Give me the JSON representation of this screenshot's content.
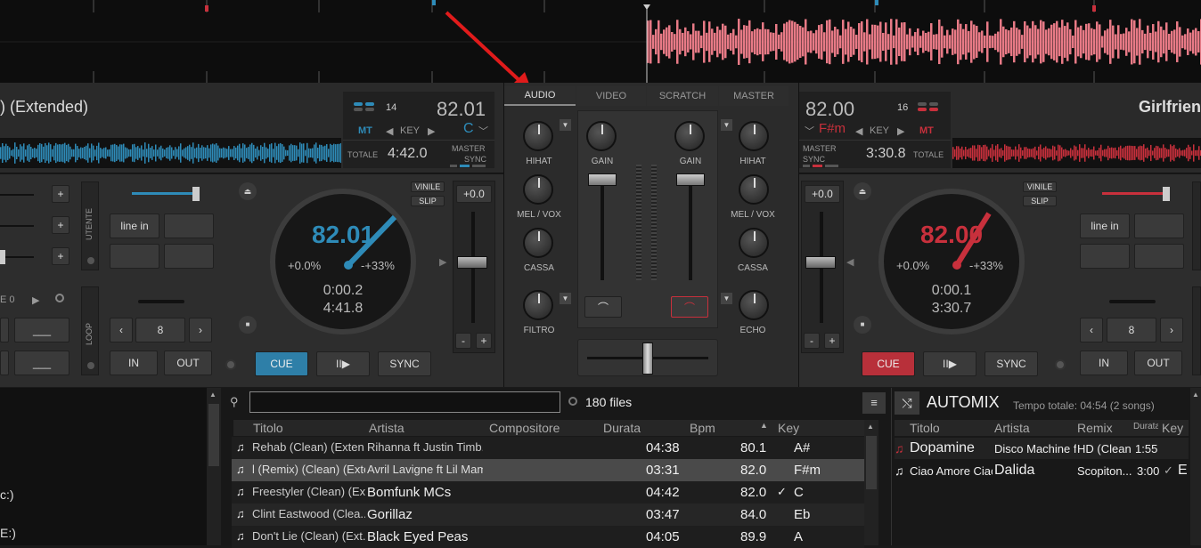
{
  "left_deck": {
    "title": ") (Extended)",
    "key_slot": "14",
    "bpm": "82.01",
    "key_mode": "MT",
    "key_label": "KEY",
    "key_value": "C",
    "totale_label": "TOTALE",
    "total_time": "4:42.0",
    "master_label": "MASTER",
    "sync_label": "SYNC",
    "vinile": "VINILE",
    "slip": "SLIP",
    "pitch": "+0.0",
    "jog_bpm": "82.01",
    "jog_pct": "+0.0%",
    "jog_range": "-+33%",
    "elapsed": "0:00.2",
    "remaining": "4:41.8",
    "line_in": "line in",
    "utente": "UTENTE",
    "loop": "LOOP",
    "loop_size": "8",
    "in": "IN",
    "out": "OUT",
    "cue": "CUE",
    "play": "II▶",
    "sync": "SYNC",
    "e0": "E 0"
  },
  "right_deck": {
    "title": "Girlfrien",
    "key_slot": "16",
    "bpm": "82.00",
    "key_mode": "MT",
    "key_label": "KEY",
    "key_value": "F#m",
    "totale_label": "TOTALE",
    "total_time": "3:30.8",
    "master_label": "MASTER",
    "sync_label": "SYNC",
    "vinile": "VINILE",
    "slip": "SLIP",
    "pitch": "+0.0",
    "jog_bpm": "82.00",
    "jog_pct": "+0.0%",
    "jog_range": "-+33%",
    "elapsed": "0:00.1",
    "remaining": "3:30.7",
    "line_in": "line in",
    "utente": "UTENTE",
    "loop": "LOOP",
    "loop_size": "8",
    "in": "IN",
    "out": "OUT",
    "cue": "CUE",
    "play": "II▶",
    "sync": "SYNC"
  },
  "mixer": {
    "tabs": [
      "AUDIO",
      "VIDEO",
      "SCRATCH",
      "MASTER"
    ],
    "hihat": "HIHAT",
    "melvox": "MEL / VOX",
    "cassa": "CASSA",
    "filtro": "FILTRO",
    "echo": "ECHO",
    "gain": "GAIN"
  },
  "browser": {
    "search_placeholder": "",
    "file_count": "180 files",
    "columns": [
      "Titolo",
      "Artista",
      "Compositore",
      "Durata",
      "Bpm",
      "Key"
    ],
    "rows": [
      {
        "title": "Rehab (Clean) (Exten...",
        "artist": "Rihanna ft Justin Timb...",
        "duration": "04:38",
        "bpm": "80.1",
        "key": "A#"
      },
      {
        "title": "l (Remix) (Clean) (Exten",
        "artist": "Avril Lavigne ft Lil Mama",
        "duration": "03:31",
        "bpm": "82.0",
        "key": "F#m"
      },
      {
        "title": "Freestyler (Clean) (Ex...",
        "artist": "Bomfunk MCs",
        "duration": "04:42",
        "bpm": "82.0",
        "key": "C"
      },
      {
        "title": "Clint Eastwood (Clea...",
        "artist": "Gorillaz",
        "duration": "03:47",
        "bpm": "84.0",
        "key": "Eb"
      },
      {
        "title": "Don't Lie (Clean) (Ext...",
        "artist": "Black Eyed Peas",
        "duration": "04:05",
        "bpm": "89.9",
        "key": "A"
      }
    ]
  },
  "sidebar": {
    "item1": "c:)",
    "item2": "E:)"
  },
  "automix": {
    "title": "AUTOMIX",
    "total": "Tempo totale: 04:54 (2 songs)",
    "columns": [
      "Titolo",
      "Artista",
      "Remix",
      "Durata",
      "Key"
    ],
    "rows": [
      {
        "title": "Dopamine",
        "artist": "Disco Machine ft",
        "remix": "HD (Clean",
        "duration": "1:55",
        "key": ""
      },
      {
        "title": "Ciao Amore Ciao",
        "artist": "Dalida",
        "remix": "Scopiton...",
        "duration": "3:00",
        "key": "E"
      }
    ]
  },
  "colors": {
    "blue": "#2e8bb8",
    "red": "#c8303c",
    "wave_red": "#e87a86"
  }
}
